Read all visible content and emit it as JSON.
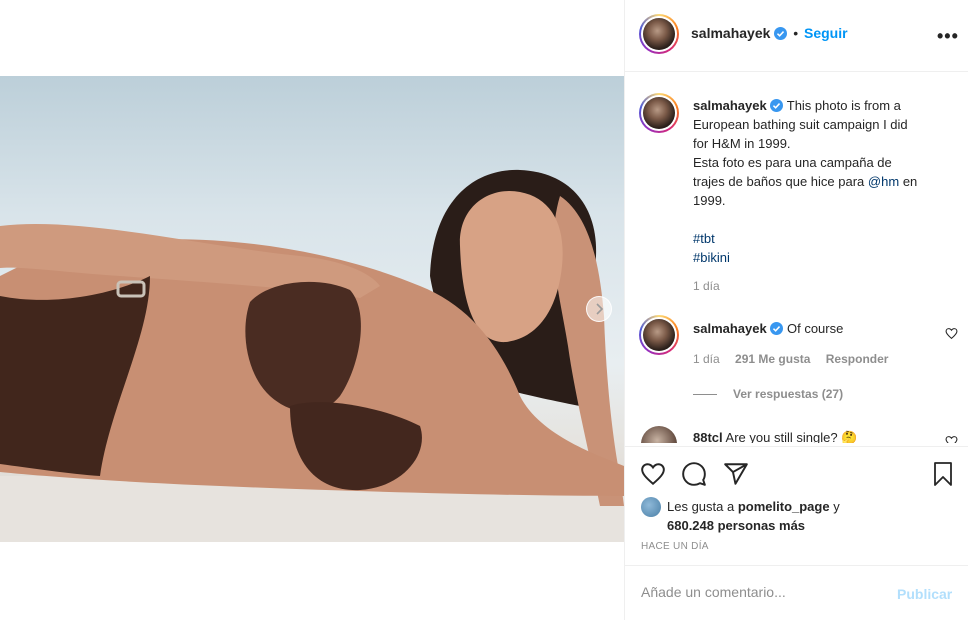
{
  "header": {
    "username": "salmahayek",
    "dot": "•",
    "follow_label": "Seguir",
    "more_label": "•••"
  },
  "caption": {
    "username": "salmahayek",
    "line1": "This photo is from a",
    "line2": "European bathing suit campaign I did",
    "line3": "for H&M in 1999.",
    "line4": "Esta foto es para una campaña de",
    "line5_pre": "trajes de baños que hice para",
    "mention": "@hm",
    "line5_post": "en",
    "line6": "1999.",
    "hashtag1": "#tbt",
    "hashtag2": "#bikini",
    "time": "1 día"
  },
  "comments": [
    {
      "username": "salmahayek",
      "text": "Of course",
      "time": "1 día",
      "likes": "291 Me gusta",
      "reply_label": "Responder",
      "view_replies": "Ver respuestas (27)"
    },
    {
      "username": "88tcl",
      "text": "Are you still single? 🤔"
    }
  ],
  "likes": {
    "prefix": "Les gusta a",
    "user": "pomelito_page",
    "conj": "y",
    "count": "680.248 personas más"
  },
  "date": "HACE UN DÍA",
  "comment_form": {
    "placeholder": "Añade un comentario...",
    "publish_label": "Publicar"
  },
  "colors": {
    "accent": "#0095f6",
    "link": "#00376b",
    "muted": "#8e8e8e",
    "publish_disabled": "#b2dffc"
  },
  "icons": [
    "verified-badge-icon",
    "more-options-icon",
    "heart-icon",
    "comment-icon",
    "share-icon",
    "bookmark-icon",
    "chevron-right-icon"
  ]
}
